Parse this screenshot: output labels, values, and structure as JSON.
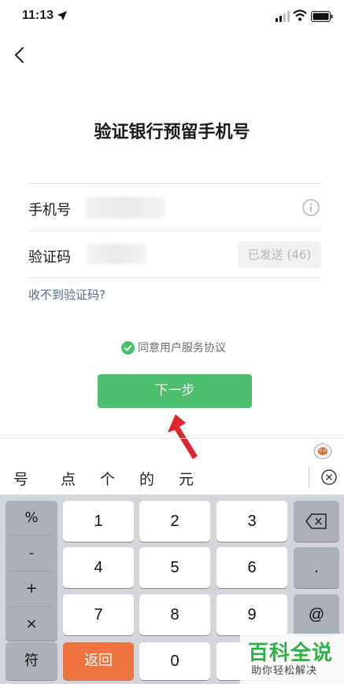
{
  "status_bar": {
    "time": "11:13"
  },
  "page": {
    "title": "验证银行预留手机号",
    "phone_label": "手机号",
    "code_label": "验证码",
    "resend_label": "已发送 (46)",
    "no_code_link": "收不到验证码?",
    "agreement": "同意用户服务协议",
    "next_button": "下一步"
  },
  "candidates": [
    "号",
    "点",
    "个",
    "的",
    "元"
  ],
  "keyboard": {
    "symbols": [
      "%",
      "-",
      "+",
      "×"
    ],
    "symbol_switch": "符",
    "back_key": "返回",
    "digits": [
      "1",
      "2",
      "3",
      "4",
      "5",
      "6",
      "7",
      "8",
      "9",
      "0"
    ],
    "right_keys": [
      ".",
      "@"
    ]
  },
  "watermark": {
    "main": "百科全说",
    "sub": "助你轻松解决"
  },
  "colors": {
    "primary_green": "#4bbf6b",
    "link_blue": "#55698d",
    "orange_key": "#f0743d",
    "annotation_red": "#e0252a"
  }
}
